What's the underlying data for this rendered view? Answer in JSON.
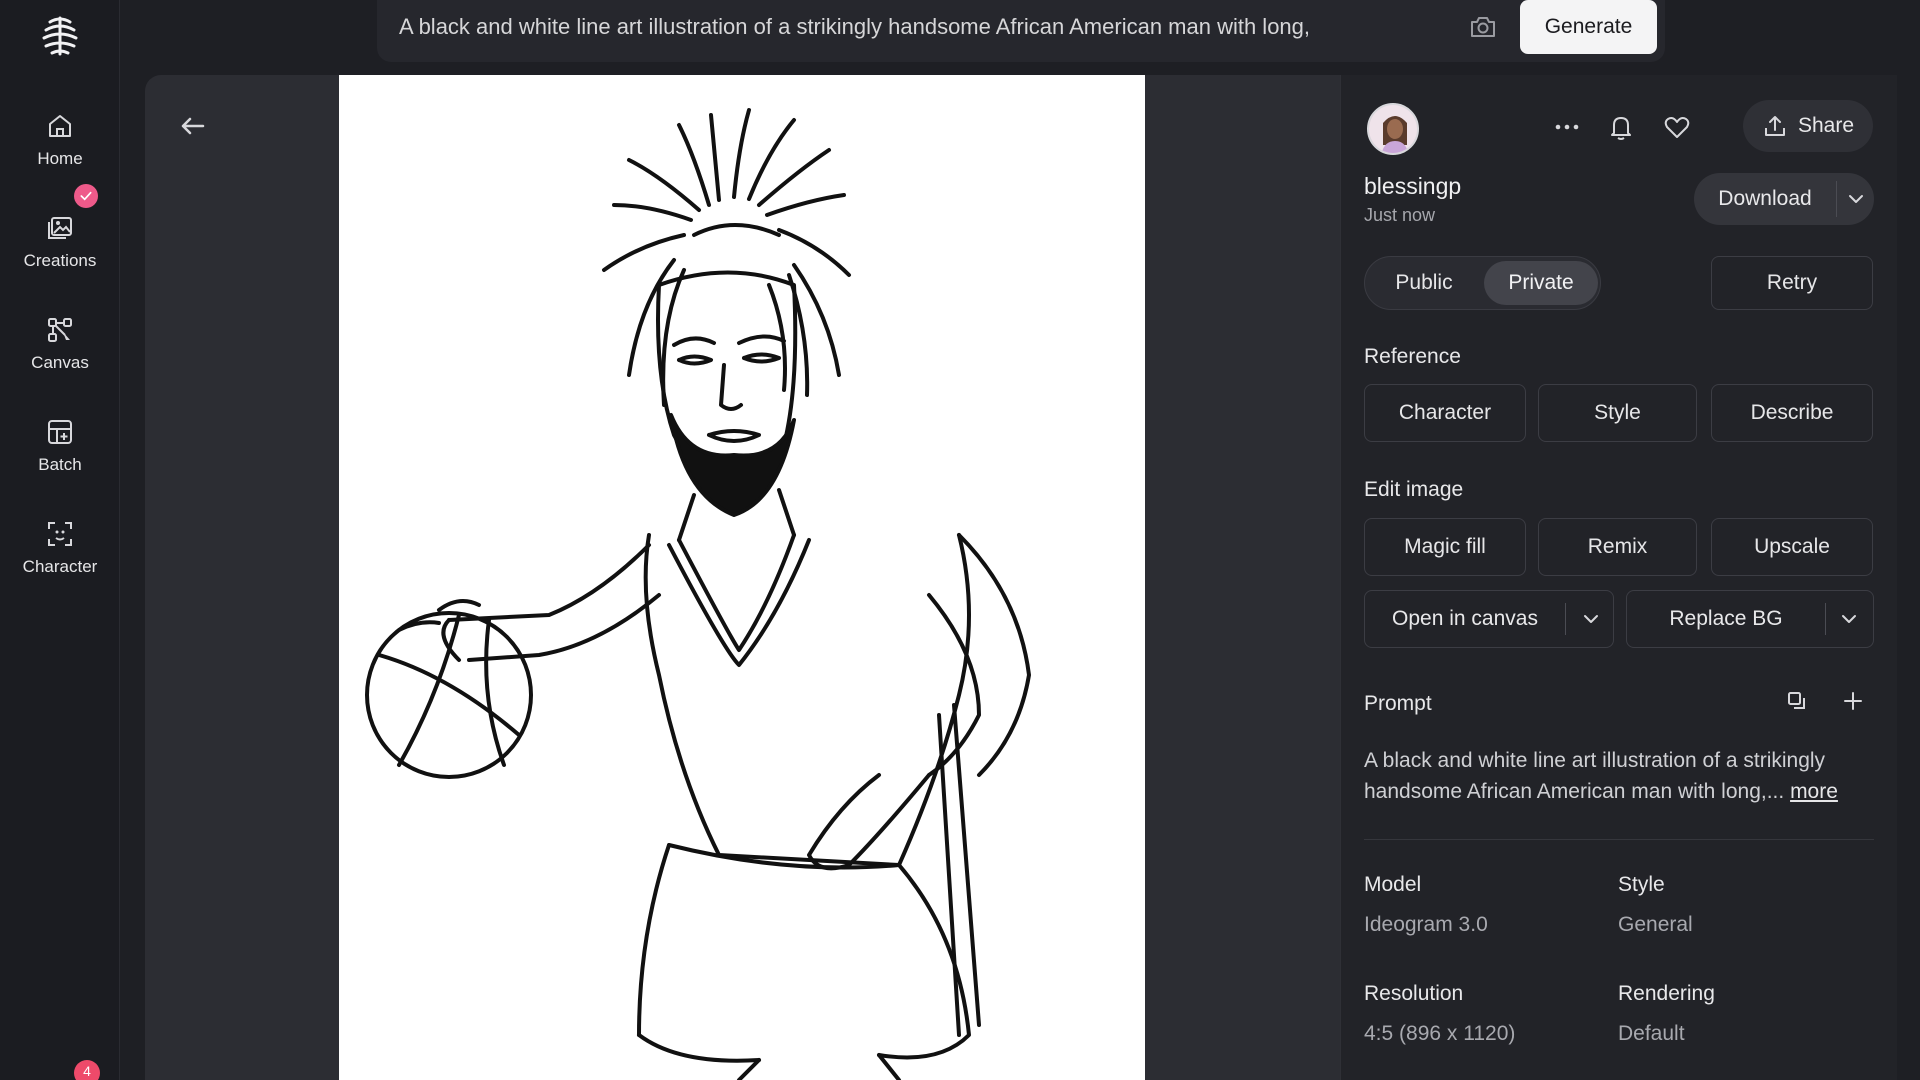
{
  "sidebar": {
    "items": [
      {
        "label": "Home",
        "icon": "home-icon"
      },
      {
        "label": "Creations",
        "icon": "images-icon"
      },
      {
        "label": "Canvas",
        "icon": "canvas-icon"
      },
      {
        "label": "Batch",
        "icon": "batch-icon"
      },
      {
        "label": "Character",
        "icon": "character-icon"
      }
    ],
    "notification_count": "4"
  },
  "prompt_bar": {
    "text": "A black and white line art illustration of a strikingly handsome African American man with long,",
    "generate_label": "Generate"
  },
  "panel": {
    "username": "blessingp",
    "timestamp": "Just now",
    "share_label": "Share",
    "download_label": "Download",
    "visibility": {
      "public_label": "Public",
      "private_label": "Private",
      "selected": "Private"
    },
    "retry_label": "Retry",
    "reference": {
      "title": "Reference",
      "buttons": [
        "Character",
        "Style",
        "Describe"
      ]
    },
    "edit_image": {
      "title": "Edit image",
      "buttons": [
        "Magic fill",
        "Remix",
        "Upscale"
      ],
      "open_in_canvas": "Open in canvas",
      "replace_bg": "Replace BG"
    },
    "prompt": {
      "title": "Prompt",
      "text": "A black and white line art illustration of a strikingly handsome African American man with long,...",
      "more_label": "more"
    },
    "meta": {
      "model_label": "Model",
      "model_value": "Ideogram 3.0",
      "style_label": "Style",
      "style_value": "General",
      "resolution_label": "Resolution",
      "resolution_value": "4:5 (896 x 1120)",
      "rendering_label": "Rendering",
      "rendering_value": "Default"
    }
  },
  "colors": {
    "background": "#1e1f24",
    "panel": "#222328",
    "accent_badge": "#ee5a8a"
  }
}
